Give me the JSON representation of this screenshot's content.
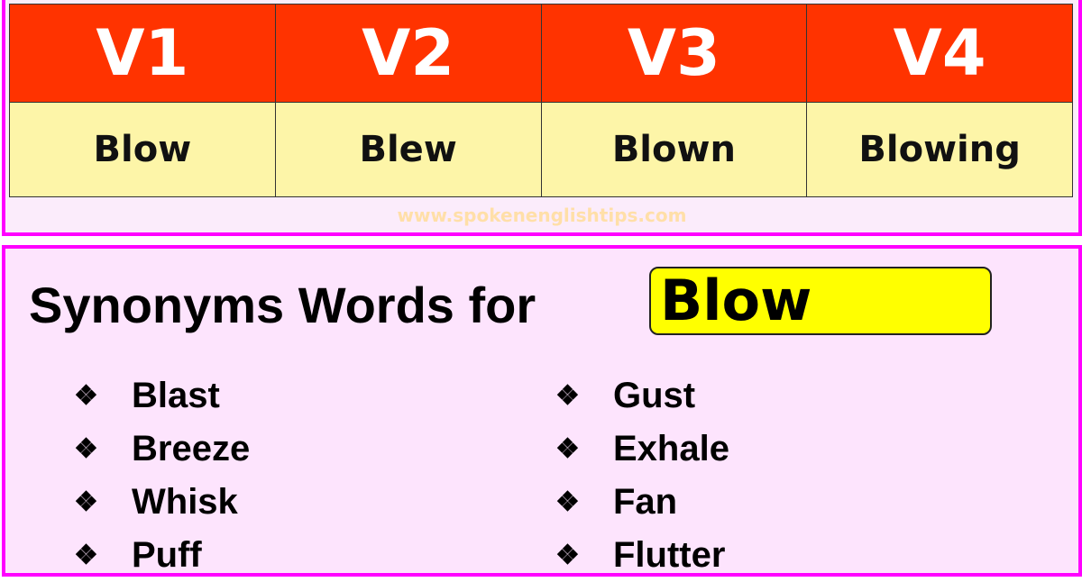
{
  "verb_forms": {
    "headers": [
      "V1",
      "V2",
      "V3",
      "V4"
    ],
    "values": [
      "Blow",
      "Blew",
      "Blown",
      "Blowing"
    ]
  },
  "watermark": "www.spokenenglishtips.com",
  "synonyms": {
    "heading": "Synonyms Words for",
    "word": "Blow",
    "bullet_icon": "❖",
    "left": [
      "Blast",
      "Breeze",
      "Whisk",
      "Puff"
    ],
    "right": [
      "Gust",
      "Exhale",
      "Fan",
      "Flutter"
    ]
  },
  "colors": {
    "border": "#ff00ff",
    "header_bg": "#ff3300",
    "value_bg": "#fdf5a8",
    "highlight": "#ffff00",
    "panel_bg": "#fde4fd"
  }
}
